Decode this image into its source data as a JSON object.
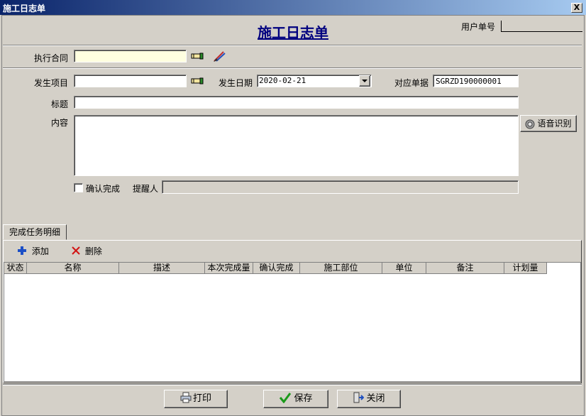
{
  "window": {
    "title": "施工日志单",
    "close_label": "X"
  },
  "header": {
    "heading": "施工日志单",
    "user_no_label": "用户单号",
    "user_no_value": ""
  },
  "form": {
    "contract_label": "执行合同",
    "contract_value": "",
    "project_label": "发生项目",
    "project_value": "",
    "date_label": "发生日期",
    "date_value": "2020-02-21",
    "ref_label": "对应单据",
    "ref_value": "SGRZD190000001",
    "title_label": "标题",
    "title_value": "",
    "content_label": "内容",
    "content_value": "",
    "voice_label": "语音识别",
    "confirm_label": "确认完成",
    "reminder_label": "提醒人",
    "reminder_value": ""
  },
  "tabs": [
    {
      "label": "完成任务明细"
    }
  ],
  "toolbar": {
    "add_label": "添加",
    "delete_label": "删除"
  },
  "grid": {
    "columns": [
      "状态",
      "名称",
      "描述",
      "本次完成量",
      "确认完成",
      "施工部位",
      "单位",
      "备注",
      "计划量"
    ]
  },
  "footer": {
    "print_label": "打印",
    "save_label": "保存",
    "close_label": "关闭"
  },
  "colors": {
    "title_start": "#0a246a",
    "title_end": "#a6caf0",
    "heading": "#00007f",
    "add_icon": "#1c4fc6",
    "delete_icon": "#d21414",
    "save_icon": "#1a9a1a"
  }
}
